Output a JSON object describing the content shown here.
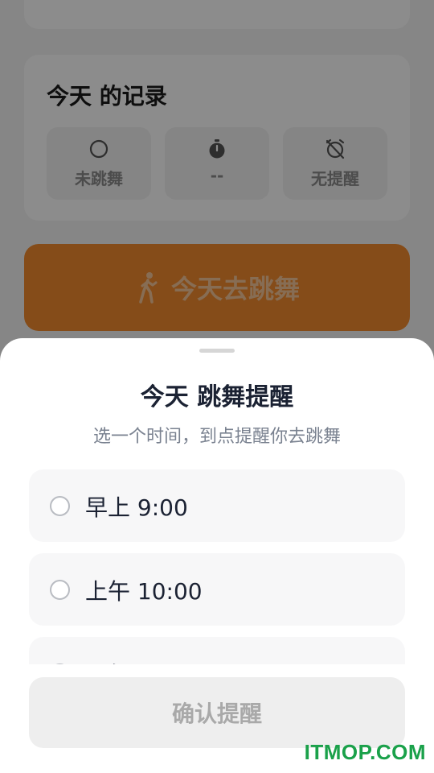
{
  "record_card": {
    "title": "今天 的记录",
    "stats": [
      {
        "icon": "circle-outline-icon",
        "label": "未跳舞"
      },
      {
        "icon": "stopwatch-icon",
        "label": "--"
      },
      {
        "icon": "alarm-off-icon",
        "label": "无提醒"
      }
    ]
  },
  "primary_action": {
    "icon": "walking-person-icon",
    "label": "今天去跳舞",
    "color": "#f28a2e"
  },
  "sheet": {
    "title": "今天 跳舞提醒",
    "subtitle": "选一个时间，到点提醒你去跳舞",
    "options": [
      {
        "label": "早上 9:00",
        "selected": false
      },
      {
        "label": "上午 10:00",
        "selected": false
      },
      {
        "label": "下午",
        "selected": false
      }
    ],
    "confirm_label": "确认提醒"
  },
  "watermark": "ITMOP.COM"
}
